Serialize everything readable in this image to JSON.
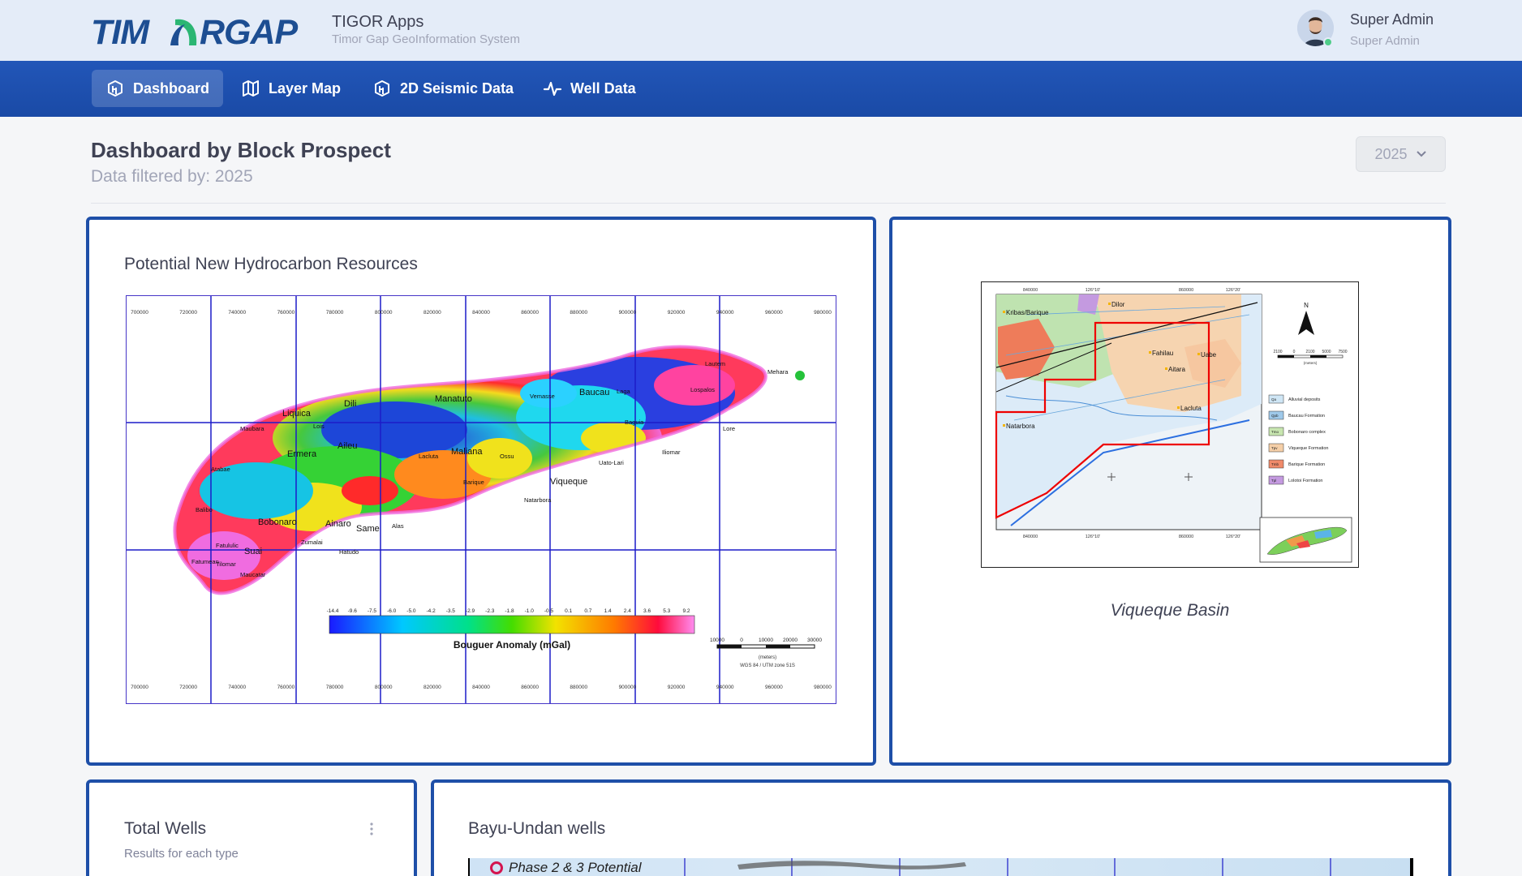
{
  "header": {
    "logo_text": "TIMORGAP",
    "app_title": "TIGOR Apps",
    "app_subtitle": "Timor Gap GeoInformation System",
    "user": {
      "name": "Super Admin",
      "role": "Super Admin",
      "status_color": "#50cd89"
    }
  },
  "nav": {
    "items": [
      {
        "label": "Dashboard",
        "icon": "dashboard-icon",
        "active": true
      },
      {
        "label": "Layer Map",
        "icon": "map-icon",
        "active": false
      },
      {
        "label": "2D Seismic Data",
        "icon": "seismic-icon",
        "active": false
      },
      {
        "label": "Well Data",
        "icon": "pulse-icon",
        "active": false
      }
    ]
  },
  "page": {
    "title": "Dashboard by Block Prospect",
    "subtitle": "Data filtered by: 2025",
    "year_filter": "2025"
  },
  "cards": {
    "hydrocarbon": {
      "title": "Potential New Hydrocarbon Resources",
      "map": {
        "x_ticks": [
          "700000",
          "720000",
          "740000",
          "760000",
          "780000",
          "800000",
          "820000",
          "840000",
          "860000",
          "880000",
          "900000",
          "920000",
          "940000",
          "960000",
          "980000"
        ],
        "place_labels": [
          "Liquica",
          "Dili",
          "Manatuto",
          "Vemasse",
          "Baucau",
          "Laga",
          "Lautem",
          "Mehara",
          "Lospalos",
          "Aileu",
          "Ermera",
          "Maubara",
          "Lois",
          "Atabae",
          "Bobonaro",
          "Balibo",
          "Suai",
          "Zumalai",
          "Same",
          "Ainaro",
          "Viqueque",
          "Uato-Lari",
          "Lore",
          "Maliana",
          "Tilomar",
          "Fatululic",
          "Hatudo",
          "Alas",
          "Barique",
          "Natarbora",
          "Ossu",
          "Baguia",
          "Iliomar",
          "Lacluta",
          "Maucatar",
          "Fatumean"
        ],
        "colorbar_values": [
          "-14.4",
          "-9.6",
          "-7.5",
          "-6.0",
          "-5.0",
          "-4.2",
          "-3.5",
          "-2.9",
          "-2.3",
          "-1.8",
          "-1.0",
          "-0.5",
          "0.1",
          "0.7",
          "1.4",
          "2.4",
          "3.6",
          "5.3",
          "9.2"
        ],
        "colorbar_label": "Bouguer Anomaly (mGal)",
        "scale_values": [
          "10000",
          "0",
          "10000",
          "20000",
          "30000"
        ],
        "scale_unit": "(meters)",
        "projection": "WGS 84 / UTM zone 51S"
      }
    },
    "basin": {
      "caption": "Viqueque Basin",
      "map": {
        "top_ticks": [
          "840000",
          "126°10'",
          "860000",
          "126°20'"
        ],
        "bottom_ticks": [
          "840000",
          "126°10'",
          "860000",
          "126°20'"
        ],
        "places": [
          "Kribas/Barique",
          "Dilor",
          "Natarbora",
          "Fahilau",
          "Uabe",
          "Aitara",
          "Lacluta"
        ],
        "north_label": "N",
        "scale_values": [
          "2100",
          "0",
          "2100",
          "5000",
          "7500"
        ],
        "scale_unit": "(meters)",
        "legend": [
          {
            "code": "Qa",
            "name": "Alluvial deposits",
            "color": "#cfe6f5"
          },
          {
            "code": "Qpb",
            "name": "Baucau Formation",
            "color": "#9fc9ea"
          },
          {
            "code": "Tmo",
            "name": "Bobonaro complex",
            "color": "#c8e6b0"
          },
          {
            "code": "Tpv",
            "name": "Viqueque Formation",
            "color": "#f5cfa8"
          },
          {
            "code": "Tmb",
            "name": "Barique Formation",
            "color": "#f08a6a"
          },
          {
            "code": "Tpl",
            "name": "Lolotoi Formation",
            "color": "#c49ae0"
          }
        ]
      }
    },
    "total_wells": {
      "title": "Total Wells",
      "subtitle": "Results for each type"
    },
    "bayu_undan": {
      "title": "Bayu-Undan wells",
      "legend_text": "Phase 2 & 3  Potential"
    }
  },
  "colors": {
    "nav_bg": "#1e4fa8",
    "card_border": "#1e4fa8",
    "header_bg": "#e4ecf8"
  }
}
